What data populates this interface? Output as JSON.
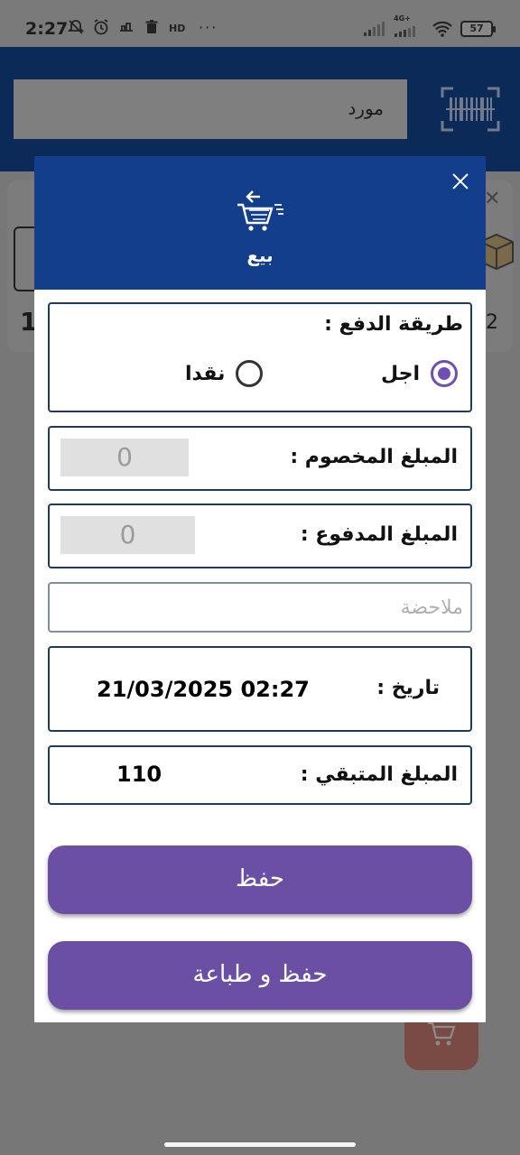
{
  "status_bar": {
    "time": "2:27",
    "battery": "57",
    "network_label": "4G+"
  },
  "background": {
    "supplier_label": "مورد",
    "left_number": "1",
    "right_number": "2"
  },
  "dialog": {
    "title": "بيع",
    "payment_method": {
      "label": "طريقة الدفع :",
      "options": [
        {
          "label": "اجل",
          "selected": true
        },
        {
          "label": "نقدا",
          "selected": false
        }
      ]
    },
    "discount": {
      "label": "المبلغ المخصوم :",
      "value": "0"
    },
    "paid": {
      "label": "المبلغ المدفوع :",
      "value": "0"
    },
    "note": {
      "placeholder": "ملاحضة",
      "value": ""
    },
    "date": {
      "label": "تاريخ :",
      "value": "21/03/2025 02:27"
    },
    "remaining": {
      "label": "المبلغ المتبقي :",
      "value": "110"
    },
    "buttons": {
      "save": "حفظ",
      "save_print": "حفظ و طباعة"
    }
  },
  "colors": {
    "header_blue": "#133e8c",
    "accent_purple": "#6a4fa5",
    "radio_purple": "#6f4fb2"
  }
}
